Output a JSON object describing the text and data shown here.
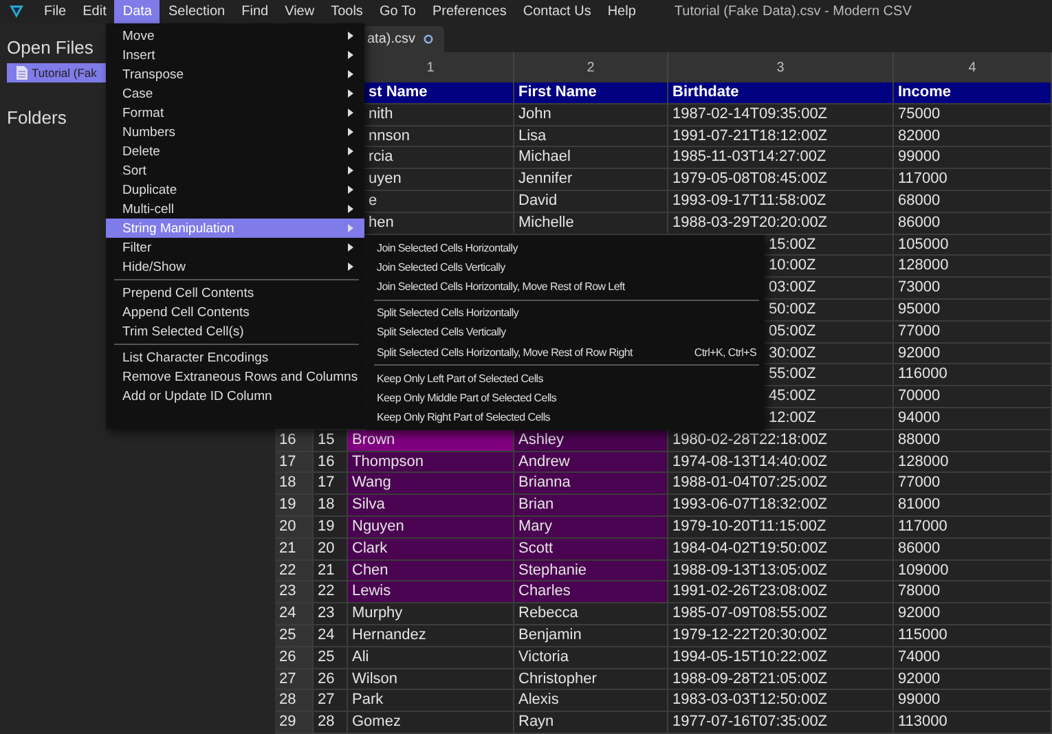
{
  "menu_bar": {
    "items": [
      {
        "label": "File",
        "selected": false
      },
      {
        "label": "Edit",
        "selected": false
      },
      {
        "label": "Data",
        "selected": true
      },
      {
        "label": "Selection",
        "selected": false
      },
      {
        "label": "Find",
        "selected": false
      },
      {
        "label": "View",
        "selected": false
      },
      {
        "label": "Tools",
        "selected": false
      },
      {
        "label": "Go To",
        "selected": false
      },
      {
        "label": "Preferences",
        "selected": false
      },
      {
        "label": "Contact Us",
        "selected": false
      },
      {
        "label": "Help",
        "selected": false
      }
    ],
    "title": "Tutorial (Fake Data).csv - Modern CSV"
  },
  "sidebar": {
    "open_files_heading": "Open Files",
    "files": [
      {
        "label": "Tutorial (Fak",
        "selected": true
      }
    ],
    "folders_heading": "Folders"
  },
  "tabs": [
    {
      "label": "ata).csv",
      "selected": true
    }
  ],
  "table": {
    "column_numbers": [
      "1",
      "2",
      "3",
      "4"
    ],
    "header_row": [
      "st Name",
      "First Name",
      "Birthdate",
      "Income"
    ],
    "rows": [
      {
        "label": null,
        "id": null,
        "cells": [
          "nith",
          "John",
          "1987-02-14T09:35:00Z",
          "75000"
        ],
        "selected": false
      },
      {
        "label": null,
        "id": null,
        "cells": [
          "nnson",
          "Lisa",
          "1991-07-21T18:12:00Z",
          "82000"
        ],
        "selected": false
      },
      {
        "label": null,
        "id": null,
        "cells": [
          "rcia",
          "Michael",
          "1985-11-03T14:27:00Z",
          "99000"
        ],
        "selected": false
      },
      {
        "label": null,
        "id": null,
        "cells": [
          "uyen",
          "Jennifer",
          "1979-05-08T08:45:00Z",
          "117000"
        ],
        "selected": false
      },
      {
        "label": null,
        "id": null,
        "cells": [
          "e",
          "David",
          "1993-09-17T11:58:00Z",
          "68000"
        ],
        "selected": false
      },
      {
        "label": null,
        "id": null,
        "cells": [
          "hen",
          "Michelle",
          "1988-03-29T20:20:00Z",
          "86000"
        ],
        "selected": false
      },
      {
        "label": null,
        "id": null,
        "cells": [
          null,
          null,
          "15:00Z",
          "105000"
        ]
      },
      {
        "label": null,
        "id": null,
        "cells": [
          null,
          null,
          "10:00Z",
          "128000"
        ]
      },
      {
        "label": null,
        "id": null,
        "cells": [
          null,
          null,
          "03:00Z",
          "73000"
        ]
      },
      {
        "label": null,
        "id": null,
        "cells": [
          null,
          null,
          "50:00Z",
          "95000"
        ]
      },
      {
        "label": null,
        "id": null,
        "cells": [
          null,
          null,
          "05:00Z",
          "77000"
        ]
      },
      {
        "label": null,
        "id": null,
        "cells": [
          null,
          null,
          "30:00Z",
          "92000"
        ]
      },
      {
        "label": null,
        "id": null,
        "cells": [
          null,
          null,
          "55:00Z",
          "116000"
        ]
      },
      {
        "label": null,
        "id": null,
        "cells": [
          null,
          null,
          "45:00Z",
          "70000"
        ]
      },
      {
        "label": null,
        "id": null,
        "cells": [
          null,
          null,
          "12:00Z",
          "94000"
        ]
      },
      {
        "label": "16",
        "id": "15",
        "cells": [
          "Brown",
          "Ashley",
          "1980-02-28T22:18:00Z",
          "88000"
        ],
        "selected": true,
        "current": true
      },
      {
        "label": "17",
        "id": "16",
        "cells": [
          "Thompson",
          "Andrew",
          "1974-08-13T14:40:00Z",
          "128000"
        ],
        "selected": true
      },
      {
        "label": "18",
        "id": "17",
        "cells": [
          "Wang",
          "Brianna",
          "1988-01-04T07:25:00Z",
          "77000"
        ],
        "selected": true
      },
      {
        "label": "19",
        "id": "18",
        "cells": [
          "Silva",
          "Brian",
          "1993-06-07T18:32:00Z",
          "81000"
        ],
        "selected": true
      },
      {
        "label": "20",
        "id": "19",
        "cells": [
          "Nguyen",
          "Mary",
          "1979-10-20T11:15:00Z",
          "117000"
        ],
        "selected": true
      },
      {
        "label": "21",
        "id": "20",
        "cells": [
          "Clark",
          "Scott",
          "1984-04-02T19:50:00Z",
          "86000"
        ],
        "selected": true
      },
      {
        "label": "22",
        "id": "21",
        "cells": [
          "Chen",
          "Stephanie",
          "1988-09-13T13:05:00Z",
          "109000"
        ],
        "selected": true
      },
      {
        "label": "23",
        "id": "22",
        "cells": [
          "Lewis",
          "Charles",
          "1991-02-26T23:08:00Z",
          "78000"
        ],
        "selected": true
      },
      {
        "label": "24",
        "id": "23",
        "cells": [
          "Murphy",
          "Rebecca",
          "1985-07-09T08:55:00Z",
          "92000"
        ],
        "selected": false
      },
      {
        "label": "25",
        "id": "24",
        "cells": [
          "Hernandez",
          "Benjamin",
          "1979-12-22T20:30:00Z",
          "115000"
        ],
        "selected": false
      },
      {
        "label": "26",
        "id": "25",
        "cells": [
          "Ali",
          "Victoria",
          "1994-05-15T10:22:00Z",
          "74000"
        ],
        "selected": false
      },
      {
        "label": "27",
        "id": "26",
        "cells": [
          "Wilson",
          "Christopher",
          "1988-09-28T21:05:00Z",
          "92000"
        ],
        "selected": false
      },
      {
        "label": "28",
        "id": "27",
        "cells": [
          "Park",
          "Alexis",
          "1983-03-03T12:50:00Z",
          "99000"
        ],
        "selected": false
      },
      {
        "label": "29",
        "id": "28",
        "cells": [
          "Gomez",
          "Rayn",
          "1977-07-16T07:35:00Z",
          "113000"
        ],
        "selected": false
      }
    ]
  },
  "data_menu": {
    "items": [
      {
        "kind": "submenu",
        "label": "Move",
        "selected": false
      },
      {
        "kind": "submenu",
        "label": "Insert",
        "selected": false
      },
      {
        "kind": "submenu",
        "label": "Transpose",
        "selected": false
      },
      {
        "kind": "submenu",
        "label": "Case",
        "selected": false
      },
      {
        "kind": "submenu",
        "label": "Format",
        "selected": false
      },
      {
        "kind": "submenu",
        "label": "Numbers",
        "selected": false
      },
      {
        "kind": "submenu",
        "label": "Delete",
        "selected": false
      },
      {
        "kind": "submenu",
        "label": "Sort",
        "selected": false
      },
      {
        "kind": "submenu",
        "label": "Duplicate",
        "selected": false
      },
      {
        "kind": "submenu",
        "label": "Multi-cell",
        "selected": false
      },
      {
        "kind": "submenu",
        "label": "String Manipulation",
        "selected": true
      },
      {
        "kind": "submenu",
        "label": "Filter",
        "selected": false
      },
      {
        "kind": "submenu",
        "label": "Hide/Show",
        "selected": false
      },
      {
        "kind": "separator"
      },
      {
        "kind": "command",
        "label": "Prepend Cell Contents",
        "selected": false
      },
      {
        "kind": "command",
        "label": "Append Cell Contents",
        "selected": false
      },
      {
        "kind": "command",
        "label": "Trim Selected Cell(s)",
        "selected": false
      },
      {
        "kind": "separator"
      },
      {
        "kind": "command",
        "label": "List Character Encodings",
        "selected": false
      },
      {
        "kind": "command",
        "label": "Remove Extraneous Rows and Columns",
        "selected": false
      },
      {
        "kind": "command",
        "label": "Add or Update ID Column",
        "selected": false
      }
    ]
  },
  "string_manipulation_menu": {
    "items": [
      {
        "kind": "command",
        "label": "Join Selected Cells Horizontally"
      },
      {
        "kind": "command",
        "label": "Join Selected Cells Vertically"
      },
      {
        "kind": "command",
        "label": "Join Selected Cells Horizontally, Move Rest of Row Left"
      },
      {
        "kind": "separator"
      },
      {
        "kind": "command",
        "label": "Split Selected Cells Horizontally"
      },
      {
        "kind": "command",
        "label": "Split Selected Cells Vertically"
      },
      {
        "kind": "command",
        "label": "Split Selected Cells Horizontally, Move Rest of Row Right",
        "shortcut": "Ctrl+K, Ctrl+S"
      },
      {
        "kind": "separator"
      },
      {
        "kind": "command",
        "label": "Keep Only Left Part of Selected Cells"
      },
      {
        "kind": "command",
        "label": "Keep Only Middle Part of Selected Cells"
      },
      {
        "kind": "command",
        "label": "Keep Only Right Part of Selected Cells"
      }
    ]
  }
}
